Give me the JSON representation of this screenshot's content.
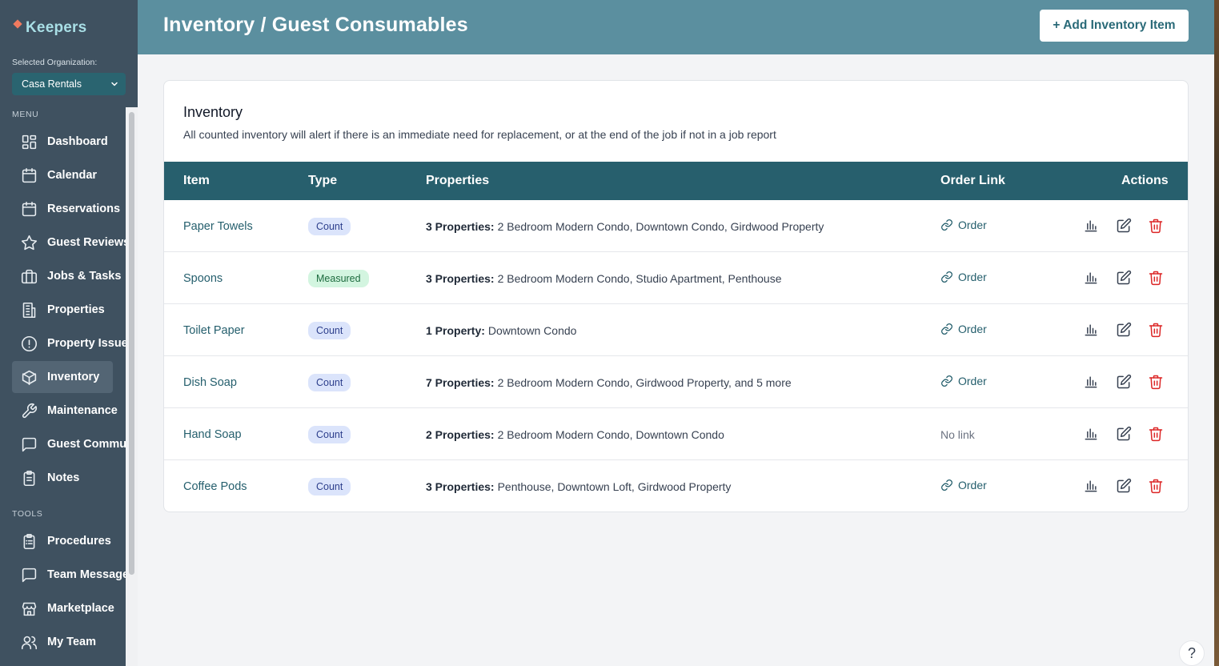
{
  "app": {
    "logo_text": "Keepers",
    "org_label": "Selected Organization:",
    "org_value": "Casa Rentals"
  },
  "sidebar": {
    "menu_label": "MENU",
    "tools_label": "TOOLS",
    "menu_items": [
      {
        "label": "Dashboard",
        "icon": "dashboard-icon"
      },
      {
        "label": "Calendar",
        "icon": "calendar-icon"
      },
      {
        "label": "Reservations",
        "icon": "calendar-icon"
      },
      {
        "label": "Guest Reviews",
        "icon": "star-icon"
      },
      {
        "label": "Jobs & Tasks",
        "icon": "briefcase-icon"
      },
      {
        "label": "Properties",
        "icon": "building-icon"
      },
      {
        "label": "Property Issues",
        "icon": "alert-circle-icon"
      },
      {
        "label": "Inventory",
        "icon": "cube-icon",
        "active": true
      },
      {
        "label": "Maintenance",
        "icon": "wrench-icon"
      },
      {
        "label": "Guest Communication",
        "icon": "chat-icon"
      },
      {
        "label": "Notes",
        "icon": "clipboard-icon"
      }
    ],
    "tool_items": [
      {
        "label": "Procedures",
        "icon": "clipboard-list-icon"
      },
      {
        "label": "Team Messages",
        "icon": "chat-icon"
      },
      {
        "label": "Marketplace",
        "icon": "store-icon"
      },
      {
        "label": "My Team",
        "icon": "users-icon"
      }
    ]
  },
  "header": {
    "title": "Inventory / Guest Consumables",
    "add_button": "+ Add Inventory Item"
  },
  "card": {
    "title": "Inventory",
    "description": "All counted inventory will alert if there is an immediate need for replacement, or at the end of the job if not in a job report"
  },
  "table": {
    "columns": [
      "Item",
      "Type",
      "Properties",
      "Order Link",
      "Actions"
    ],
    "rows": [
      {
        "item": "Paper Towels",
        "type": "Count",
        "props_count": "3 Properties:",
        "props_list": "2 Bedroom Modern Condo, Downtown Condo, Girdwood Property",
        "order": "Order",
        "has_link": true
      },
      {
        "item": "Spoons",
        "type": "Measured",
        "props_count": "3 Properties:",
        "props_list": "2 Bedroom Modern Condo, Studio Apartment, Penthouse",
        "order": "Order",
        "has_link": true
      },
      {
        "item": "Toilet Paper",
        "type": "Count",
        "props_count": "1 Property:",
        "props_list": "Downtown Condo",
        "order": "Order",
        "has_link": true
      },
      {
        "item": "Dish Soap",
        "type": "Count",
        "props_count": "7 Properties:",
        "props_list": "2 Bedroom Modern Condo, Girdwood Property, and 5 more",
        "order": "Order",
        "has_link": true
      },
      {
        "item": "Hand Soap",
        "type": "Count",
        "props_count": "2 Properties:",
        "props_list": "2 Bedroom Modern Condo, Downtown Condo",
        "order": "No link",
        "has_link": false
      },
      {
        "item": "Coffee Pods",
        "type": "Count",
        "props_count": "3 Properties:",
        "props_list": "Penthouse, Downtown Loft, Girdwood Property",
        "order": "Order",
        "has_link": true
      }
    ]
  },
  "help_label": "?",
  "colors": {
    "sidebar": "#3f5160",
    "header": "#5b8f9f",
    "table_header": "#275f6d",
    "accent": "#255f6d",
    "delete": "#dc2626"
  }
}
